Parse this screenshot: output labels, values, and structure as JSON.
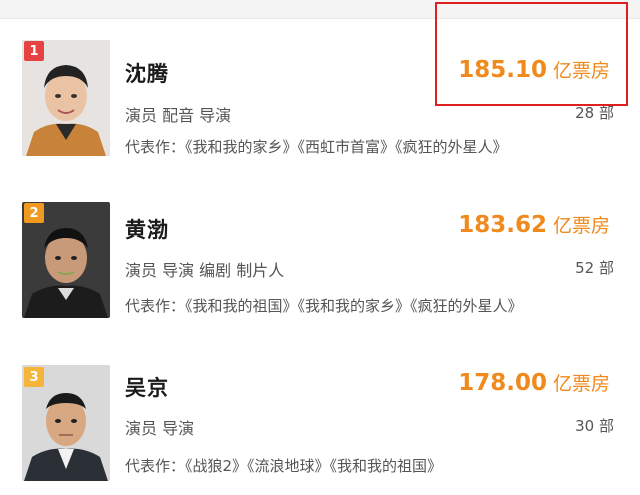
{
  "colors": {
    "accent": "#f08a1c",
    "highlight": "#e02020",
    "rank1": "#e64242",
    "rank2": "#f29a1f",
    "rank3": "#f5b43a"
  },
  "actors": [
    {
      "rank": "1",
      "name": "沈腾",
      "roles": "演员  配音  导演",
      "box_office": "185.10",
      "box_unit": "亿票房",
      "film_count": "28 部",
      "works": "代表作：《我和我的家乡》《西虹市首富》《疯狂的外星人》"
    },
    {
      "rank": "2",
      "name": "黄渤",
      "roles": "演员  导演  编剧  制片人",
      "box_office": "183.62",
      "box_unit": "亿票房",
      "film_count": "52 部",
      "works": "代表作：《我和我的祖国》《我和我的家乡》《疯狂的外星人》"
    },
    {
      "rank": "3",
      "name": "吴京",
      "roles": "演员  导演",
      "box_office": "178.00",
      "box_unit": "亿票房",
      "film_count": "30 部",
      "works": "代表作：《战狼2》《流浪地球》《我和我的祖国》"
    }
  ]
}
